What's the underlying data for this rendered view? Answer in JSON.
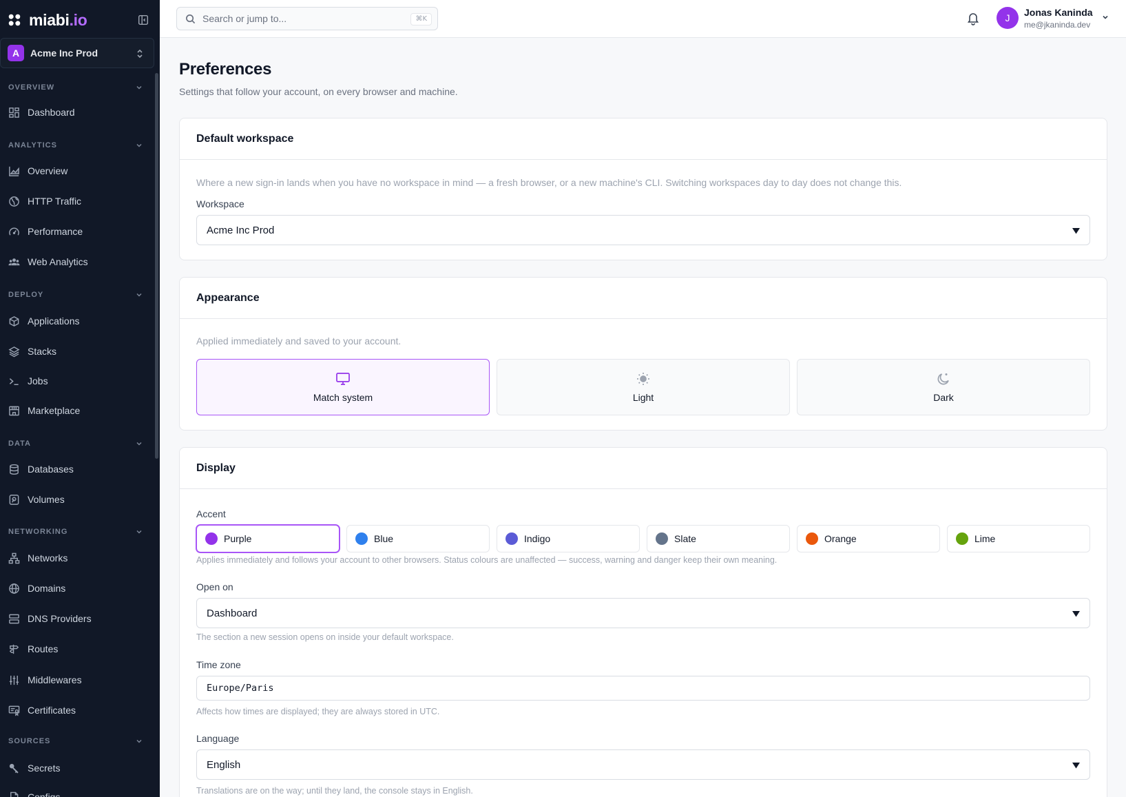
{
  "brand": {
    "name": "miabi",
    "tld": ".io"
  },
  "workspace_switcher": {
    "badge": "A",
    "name": "Acme Inc Prod"
  },
  "sidebar": {
    "sections": [
      {
        "label": "OVERVIEW"
      },
      {
        "label": "ANALYTICS"
      },
      {
        "label": "DEPLOY"
      },
      {
        "label": "DATA"
      },
      {
        "label": "NETWORKING"
      },
      {
        "label": "SOURCES"
      }
    ],
    "items": [
      {
        "label": "Dashboard",
        "icon": "dashboard-icon"
      },
      {
        "label": "Overview",
        "icon": "chart-area-icon"
      },
      {
        "label": "HTTP Traffic",
        "icon": "globe-icon"
      },
      {
        "label": "Performance",
        "icon": "gauge-icon"
      },
      {
        "label": "Web Analytics",
        "icon": "users-icon"
      },
      {
        "label": "Applications",
        "icon": "box-icon"
      },
      {
        "label": "Stacks",
        "icon": "layers-icon"
      },
      {
        "label": "Jobs",
        "icon": "terminal-icon"
      },
      {
        "label": "Marketplace",
        "icon": "store-icon"
      },
      {
        "label": "Databases",
        "icon": "database-icon"
      },
      {
        "label": "Volumes",
        "icon": "hard-drive-icon"
      },
      {
        "label": "Networks",
        "icon": "network-icon"
      },
      {
        "label": "Domains",
        "icon": "globe-icon"
      },
      {
        "label": "DNS Providers",
        "icon": "server-icon"
      },
      {
        "label": "Routes",
        "icon": "signpost-icon"
      },
      {
        "label": "Middlewares",
        "icon": "sliders-icon"
      },
      {
        "label": "Certificates",
        "icon": "certificate-icon"
      },
      {
        "label": "Secrets",
        "icon": "key-icon"
      },
      {
        "label": "Configs",
        "icon": "file-icon"
      }
    ]
  },
  "topbar": {
    "search_placeholder": "Search or jump to...",
    "search_shortcut": "⌘K",
    "user": {
      "initial": "J",
      "name": "Jonas Kaninda",
      "email": "me@jkaninda.dev"
    }
  },
  "page": {
    "title": "Preferences",
    "subtitle": "Settings that follow your account, on every browser and machine."
  },
  "default_workspace": {
    "title": "Default workspace",
    "description": "Where a new sign-in lands when you have no workspace in mind — a fresh browser, or a new machine's CLI. Switching workspaces day to day does not change this.",
    "field_label": "Workspace",
    "value": "Acme Inc Prod"
  },
  "appearance": {
    "title": "Appearance",
    "description": "Applied immediately and saved to your account.",
    "options": [
      {
        "label": "Match system",
        "icon": "monitor-icon",
        "selected": true
      },
      {
        "label": "Light",
        "icon": "sun-icon",
        "selected": false
      },
      {
        "label": "Dark",
        "icon": "moon-icon",
        "selected": false
      }
    ]
  },
  "display": {
    "title": "Display",
    "accent_label": "Accent",
    "accents": [
      {
        "label": "Purple",
        "color": "#9333ea",
        "selected": true
      },
      {
        "label": "Blue",
        "color": "#2f80ed",
        "selected": false
      },
      {
        "label": "Indigo",
        "color": "#5b5bd6",
        "selected": false
      },
      {
        "label": "Slate",
        "color": "#64748b",
        "selected": false
      },
      {
        "label": "Orange",
        "color": "#ea580c",
        "selected": false
      },
      {
        "label": "Lime",
        "color": "#65a30d",
        "selected": false
      }
    ],
    "accent_help": "Applies immediately and follows your account to other browsers. Status colours are unaffected — success, warning and danger keep their own meaning.",
    "open_on_label": "Open on",
    "open_on_value": "Dashboard",
    "open_on_help": "The section a new session opens on inside your default workspace.",
    "timezone_label": "Time zone",
    "timezone_value": "Europe/Paris",
    "timezone_help": "Affects how times are displayed; they are always stored in UTC.",
    "language_label": "Language",
    "language_value": "English",
    "language_help": "Translations are on the way; until they land, the console stays in English."
  },
  "colors": {
    "accent": "#9333ea",
    "sidebar_bg": "#111827"
  }
}
